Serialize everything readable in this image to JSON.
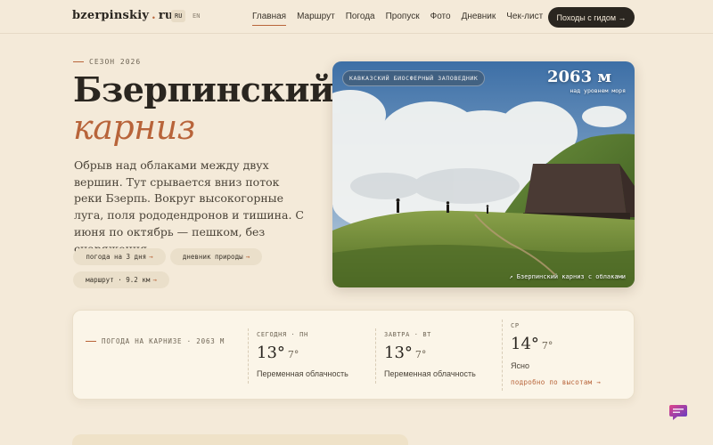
{
  "nav": {
    "logo_main": "bzerpinskiy",
    "logo_dot": ".",
    "logo_tld": "ru",
    "lang_ru": "RU",
    "lang_en": "EN",
    "links": [
      "Главная",
      "Маршрут",
      "Погода",
      "Пропуск",
      "Фото",
      "Дневник",
      "Чек-лист"
    ],
    "cta": "Походы с гидом →"
  },
  "hero": {
    "season": "СЕЗОН 2026",
    "title_line1": "Бзерпинский",
    "title_line2": "карниз",
    "lead": "Обрыв над облаками между двух вершин. Тут срывается вниз поток реки Бзерпь. Вокруг высокогорные луга, поля рододендронов и тишина. С июня по октябрь — пешком, без снаряжения.",
    "chips": [
      {
        "label": "погода на 3 дня",
        "arrow": "→"
      },
      {
        "label": "дневник природы",
        "arrow": "→"
      },
      {
        "label": "маршрут · 9.2 км",
        "arrow": "→"
      }
    ]
  },
  "image": {
    "badge": "КАВКАЗСКИЙ БИОСФЕРНЫЙ ЗАПОВЕДНИК",
    "altitude": "2063 м",
    "altitude_sub": "над уровнем моря",
    "caption": "↗ Бзерпинский карниз с облаками"
  },
  "weather": {
    "label": "ПОГОДА НА КАРНИЗЕ · 2063 М",
    "days": [
      {
        "day": "СЕГОДНЯ · ПН",
        "high": "13°",
        "low": "7°",
        "desc": "Переменная облачность"
      },
      {
        "day": "ЗАВТРА · ВТ",
        "high": "13°",
        "low": "7°",
        "desc": "Переменная облачность"
      },
      {
        "day": "СР",
        "high": "14°",
        "low": "7°",
        "desc": "Ясно"
      }
    ],
    "link": "подробно по высотам →"
  },
  "colors": {
    "background": "#f4ead9",
    "accent": "#b8643a",
    "dark": "#2a2620"
  },
  "icons": {
    "chat": "chat-bubble-icon"
  }
}
